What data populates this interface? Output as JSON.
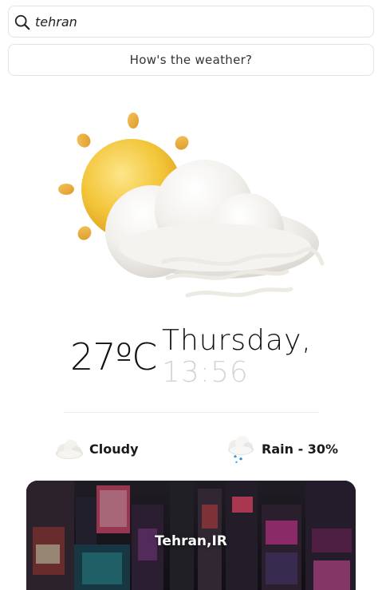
{
  "search": {
    "value": "tehran",
    "icon": "search-icon"
  },
  "submit": {
    "label": "How's the weather?"
  },
  "current": {
    "condition_icon": "sun-cloud-wind-icon",
    "temperature": "27ºC",
    "day": "Thursday,",
    "time": "13:56"
  },
  "stats": {
    "condition": {
      "icon": "cloud-icon",
      "label": "Cloudy"
    },
    "rain": {
      "icon": "rain-cloud-icon",
      "label": "Rain - 30%"
    }
  },
  "location": {
    "label": "Tehran,IR"
  },
  "colors": {
    "time_text": "#d4d4d4",
    "sun": "#f2c232",
    "cloud": "#f3f1ee"
  }
}
